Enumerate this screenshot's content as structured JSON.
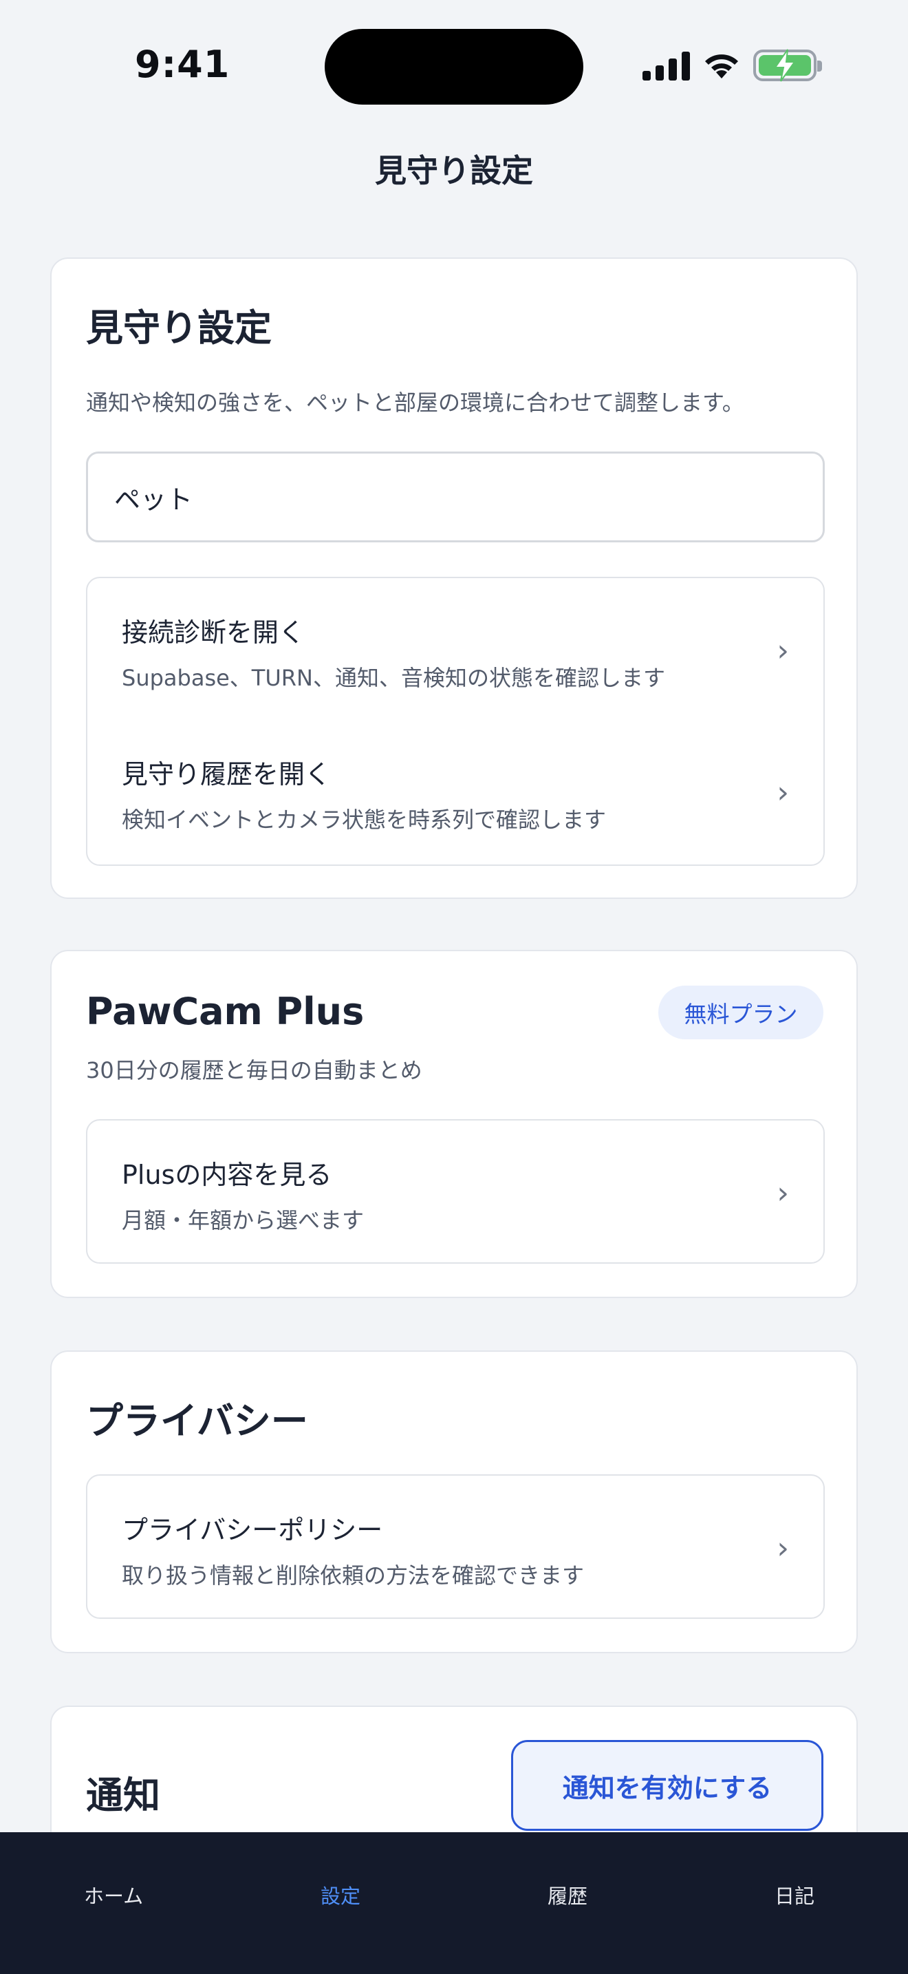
{
  "status_bar": {
    "time": "9:41"
  },
  "header": {
    "title": "見守り設定"
  },
  "monitoring_card": {
    "title": "見守り設定",
    "description": "通知や検知の強さを、ペットと部屋の環境に合わせて調整します。",
    "pet_input_value": "ペット",
    "rows": [
      {
        "title": "接続診断を開く",
        "subtitle": "Supabase、TURN、通知、音検知の状態を確認します"
      },
      {
        "title": "見守り履歴を開く",
        "subtitle": "検知イベントとカメラ状態を時系列で確認します"
      }
    ]
  },
  "plus_card": {
    "title": "PawCam Plus",
    "badge": "無料プラン",
    "description": "30日分の履歴と毎日の自動まとめ",
    "row": {
      "title": "Plusの内容を見る",
      "subtitle": "月額・年額から選べます"
    }
  },
  "privacy_card": {
    "title": "プライバシー",
    "row": {
      "title": "プライバシーポリシー",
      "subtitle": "取り扱う情報と削除依頼の方法を確認できます"
    }
  },
  "notification_card": {
    "title": "通知",
    "enable_button": "通知を有効にする"
  },
  "tab_bar": {
    "tabs": [
      {
        "label": "ホーム"
      },
      {
        "label": "設定"
      },
      {
        "label": "履歴"
      },
      {
        "label": "日記"
      }
    ],
    "active": "設定"
  },
  "colors": {
    "accent": "#2a56d6",
    "tab_active": "#4f8ff7",
    "tab_bar_bg": "#141a2b",
    "battery_green": "#5bc46a"
  }
}
